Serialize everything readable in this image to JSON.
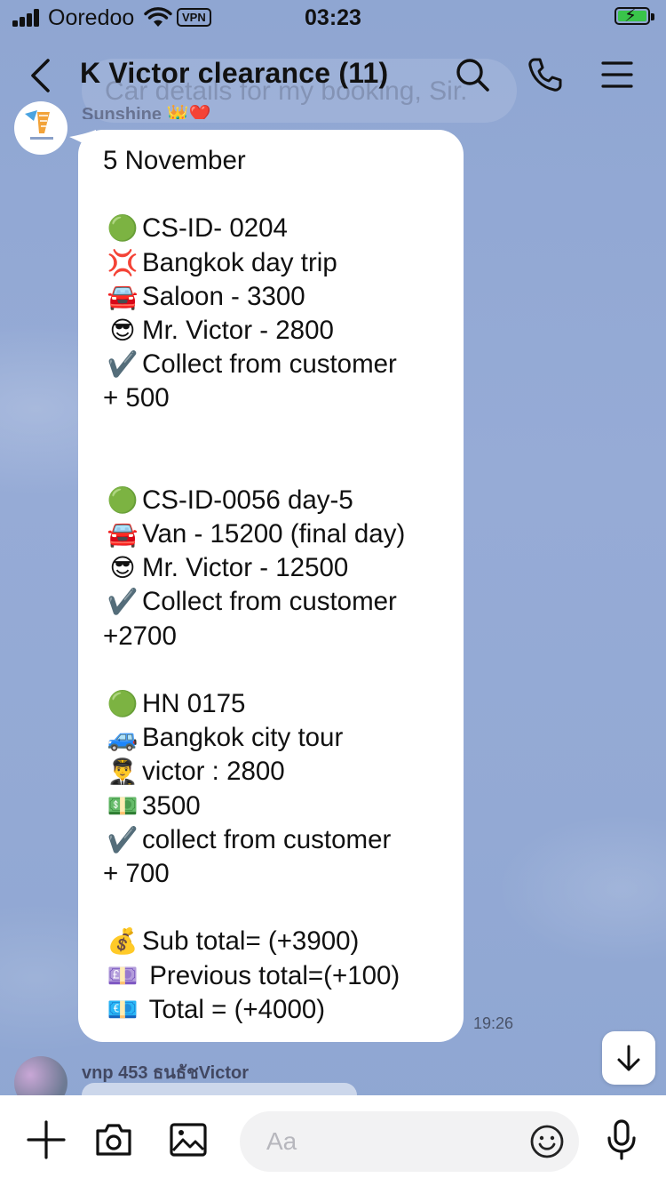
{
  "status_bar": {
    "carrier": "Ooredoo",
    "vpn_label": "VPN",
    "time": "03:23"
  },
  "header": {
    "title": "K Victor clearance  (11)",
    "behind_text": "Car details for my booking, Sir."
  },
  "message": {
    "sender": "Sunshine",
    "time": "19:26",
    "lines": [
      {
        "emoji": "",
        "text": "5 November"
      },
      {
        "emoji": "",
        "text": ""
      },
      {
        "emoji": "🟢",
        "text": "CS-ID- 0204"
      },
      {
        "emoji": "💢",
        "text": "Bangkok day trip"
      },
      {
        "emoji": "🚘",
        "text": "Saloon - 3300"
      },
      {
        "emoji": "😎",
        "text": "Mr. Victor - 2800"
      },
      {
        "emoji": "✔️",
        "text": "Collect from customer"
      },
      {
        "emoji": "",
        "text": "+ 500"
      },
      {
        "emoji": "",
        "text": ""
      },
      {
        "emoji": "",
        "text": ""
      },
      {
        "emoji": "🟢",
        "text": "CS-ID-0056 day-5"
      },
      {
        "emoji": "🚘",
        "text": "Van - 15200 (final day)"
      },
      {
        "emoji": "😎",
        "text": "Mr. Victor - 12500"
      },
      {
        "emoji": "✔️",
        "text": "Collect from customer"
      },
      {
        "emoji": "",
        "text": "+2700"
      },
      {
        "emoji": "",
        "text": ""
      },
      {
        "emoji": "🟢",
        "text": "HN 0175"
      },
      {
        "emoji": "🚙",
        "text": "Bangkok city tour"
      },
      {
        "emoji": "👨‍✈️",
        "text": "victor : 2800"
      },
      {
        "emoji": "💵",
        "text": "3500"
      },
      {
        "emoji": "✔️",
        "text": "collect from customer"
      },
      {
        "emoji": "",
        "text": "+ 700"
      },
      {
        "emoji": "",
        "text": ""
      },
      {
        "emoji": "💰",
        "text": "Sub total= (+3900)"
      },
      {
        "emoji": "💷",
        "text": " Previous total=(+100)"
      },
      {
        "emoji": "💶",
        "text": " Total = (+4000)"
      }
    ]
  },
  "next_message": {
    "sender": "vnp 453 ธนธัชVictor"
  },
  "composer": {
    "placeholder": "Aa"
  },
  "colors": {
    "chat_background": "#93a9d4",
    "bubble": "#ffffff",
    "battery_green": "#39c44a"
  }
}
